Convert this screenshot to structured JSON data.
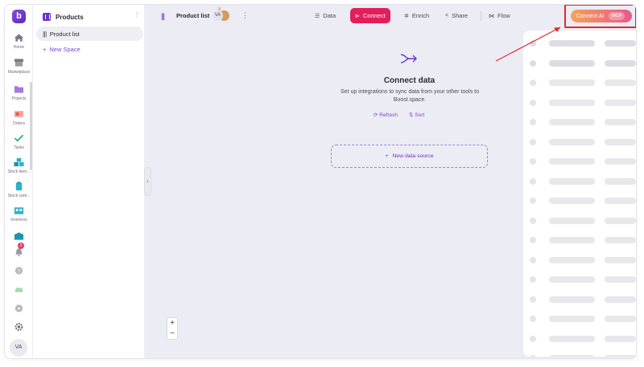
{
  "rail": {
    "logo": "b",
    "items": [
      {
        "label": "Home",
        "icon": "home-icon"
      },
      {
        "label": "Marketplace",
        "icon": "marketplace-icon"
      },
      {
        "label": "Projects",
        "icon": "folder-icon"
      },
      {
        "label": "Orders",
        "icon": "orders-icon"
      },
      {
        "label": "Tasks",
        "icon": "check-icon"
      },
      {
        "label": "Stock item...",
        "icon": "cubes-icon"
      },
      {
        "label": "Stock card...",
        "icon": "clipboard-icon"
      },
      {
        "label": "Inventory",
        "icon": "inventory-icon"
      }
    ],
    "notification_count": "3",
    "user_initials": "VA"
  },
  "spaces": {
    "title": "Products",
    "active_item": "Product list",
    "new_space_label": "New Space"
  },
  "topbar": {
    "title": "Product list",
    "avatar_initials": "VA",
    "tabs": {
      "data": "Data",
      "connect": "Connect",
      "enrich": "Enrich",
      "share": "Share",
      "flow": "Flow"
    },
    "connect_ai_label": "Connect AI",
    "mcp_badge": "MCP"
  },
  "content": {
    "title": "Connect data",
    "description": "Set up integrations to sync data from your other tools to Boost.space.",
    "refresh_label": "Refresh",
    "sort_label": "Sort",
    "new_data_source_label": "New data source"
  },
  "zoom": {
    "in": "+",
    "out": "−"
  },
  "colors": {
    "accent": "#6b32c9",
    "connect_tab": "#e21e5c",
    "connect_ai_start": "#f3a35a",
    "connect_ai_end": "#e8598a",
    "highlight": "#e02b2b",
    "canvas_bg": "#ececf4"
  }
}
